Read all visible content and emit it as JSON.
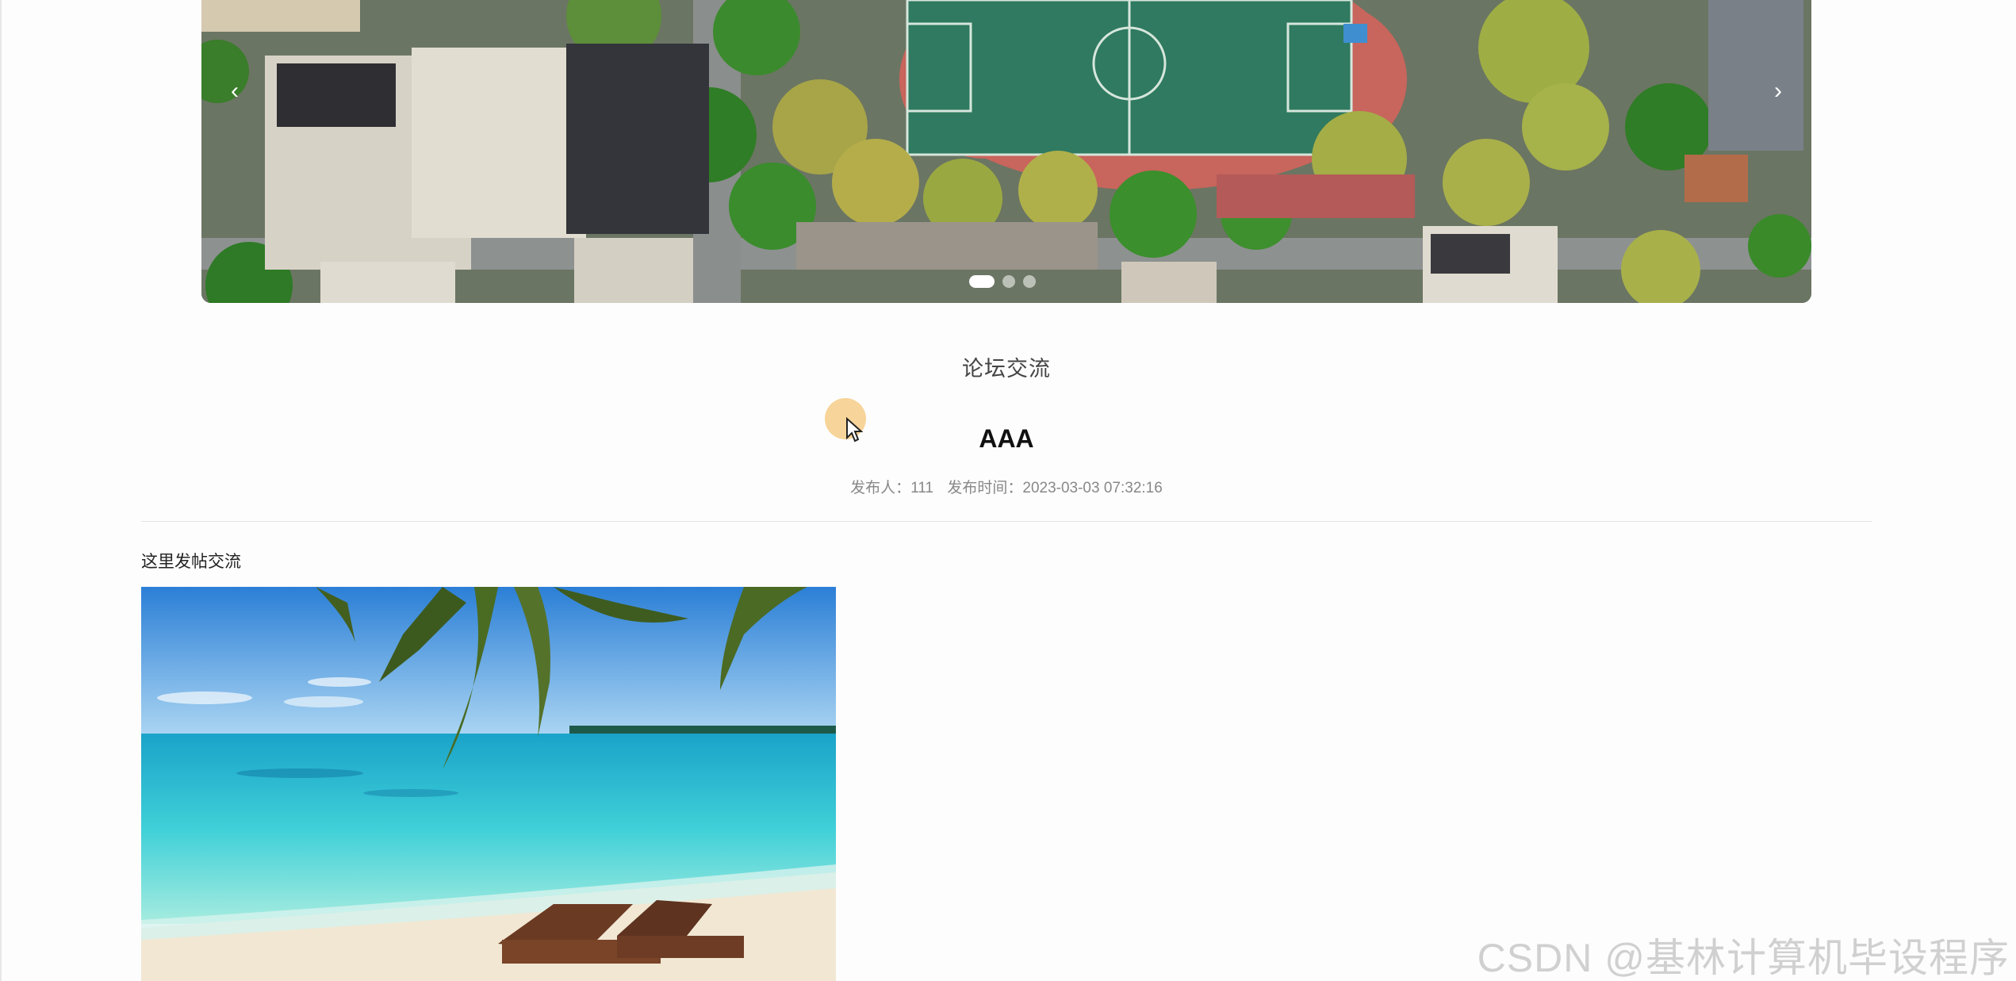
{
  "carousel": {
    "prev_label": "‹",
    "next_label": "›",
    "slides_count": 3,
    "active_slide": 1,
    "image_icon": "campus-aerial-photo"
  },
  "forum": {
    "section_title": "论坛交流"
  },
  "post": {
    "title": "AAA",
    "publisher_label": "发布人：",
    "publisher": "111",
    "time_label": "发布时间：",
    "time": "2023-03-03 07:32:16",
    "body": "这里发帖交流",
    "image_icon": "beach-palm-photo"
  },
  "watermark": "CSDN @基林计算机毕设程序",
  "colors": {
    "background": "#fdfdfd",
    "divider": "#e3e3e3",
    "meta_text": "#888888",
    "cursor_highlight": "#f5be64"
  }
}
